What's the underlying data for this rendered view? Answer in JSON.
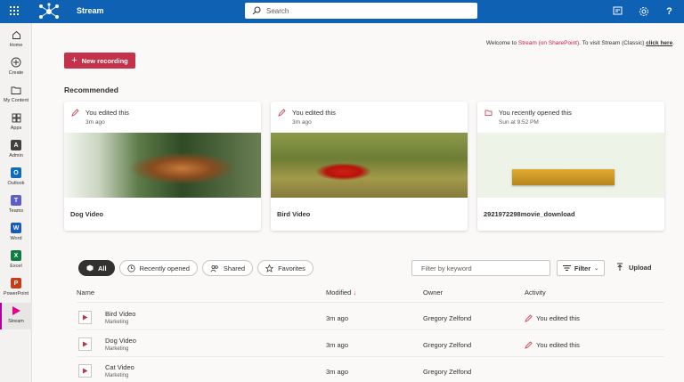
{
  "header": {
    "app_name": "Stream",
    "search_placeholder": "Search"
  },
  "leftnav": [
    {
      "label": "Home",
      "icon": "home-icon"
    },
    {
      "label": "Create",
      "icon": "plus-circle-icon"
    },
    {
      "label": "My Content",
      "icon": "folder-icon"
    },
    {
      "label": "Apps",
      "icon": "apps-icon"
    },
    {
      "label": "Admin",
      "icon": "admin-icon",
      "letter": "A",
      "color": "#404040"
    },
    {
      "label": "Outlook",
      "icon": "outlook-icon",
      "letter": "O",
      "color": "#0f6cbd"
    },
    {
      "label": "Teams",
      "icon": "teams-icon",
      "letter": "T",
      "color": "#5b5fc7"
    },
    {
      "label": "Word",
      "icon": "word-icon",
      "letter": "W",
      "color": "#185abd"
    },
    {
      "label": "Excel",
      "icon": "excel-icon",
      "letter": "X",
      "color": "#107c41"
    },
    {
      "label": "PowerPoint",
      "icon": "powerpoint-icon",
      "letter": "P",
      "color": "#c43e1c"
    },
    {
      "label": "Stream",
      "icon": "stream-icon",
      "color": "#e3008c",
      "active": true
    }
  ],
  "welcome": {
    "prefix": "Welcome to ",
    "highlight": "Stream (on SharePoint)",
    "middle": ". To visit Stream (Classic) ",
    "link": "click here",
    "suffix": "."
  },
  "new_recording": "New recording",
  "recommended": {
    "title": "Recommended",
    "cards": [
      {
        "activity": "You edited this",
        "time": "3m ago",
        "title": "Dog Video"
      },
      {
        "activity": "You edited this",
        "time": "3m ago",
        "title": "Bird Video"
      },
      {
        "activity": "You recently opened this",
        "time": "Sun at 9:52 PM",
        "title": "2921972298movie_download"
      }
    ]
  },
  "tabs": [
    "All",
    "Recently opened",
    "Shared",
    "Favorites"
  ],
  "filter": {
    "placeholder": "Filter by keyword",
    "button": "Filter",
    "upload": "Upload"
  },
  "table": {
    "columns": {
      "name": "Name",
      "modified": "Modified",
      "owner": "Owner",
      "activity": "Activity"
    },
    "rows": [
      {
        "name": "Bird Video",
        "sub": "Marketing",
        "modified": "3m ago",
        "owner": "Gregory Zelfond",
        "activity": "You edited this"
      },
      {
        "name": "Dog Video",
        "sub": "Marketing",
        "modified": "3m ago",
        "owner": "Gregory Zelfond",
        "activity": "You edited this"
      },
      {
        "name": "Cat Video",
        "sub": "Marketing",
        "modified": "3m ago",
        "owner": "Gregory Zelfond",
        "activity": ""
      }
    ]
  },
  "colors": {
    "topbar": "#0f62b3",
    "accent": "#c4314b",
    "link_pink": "#c2185b"
  }
}
